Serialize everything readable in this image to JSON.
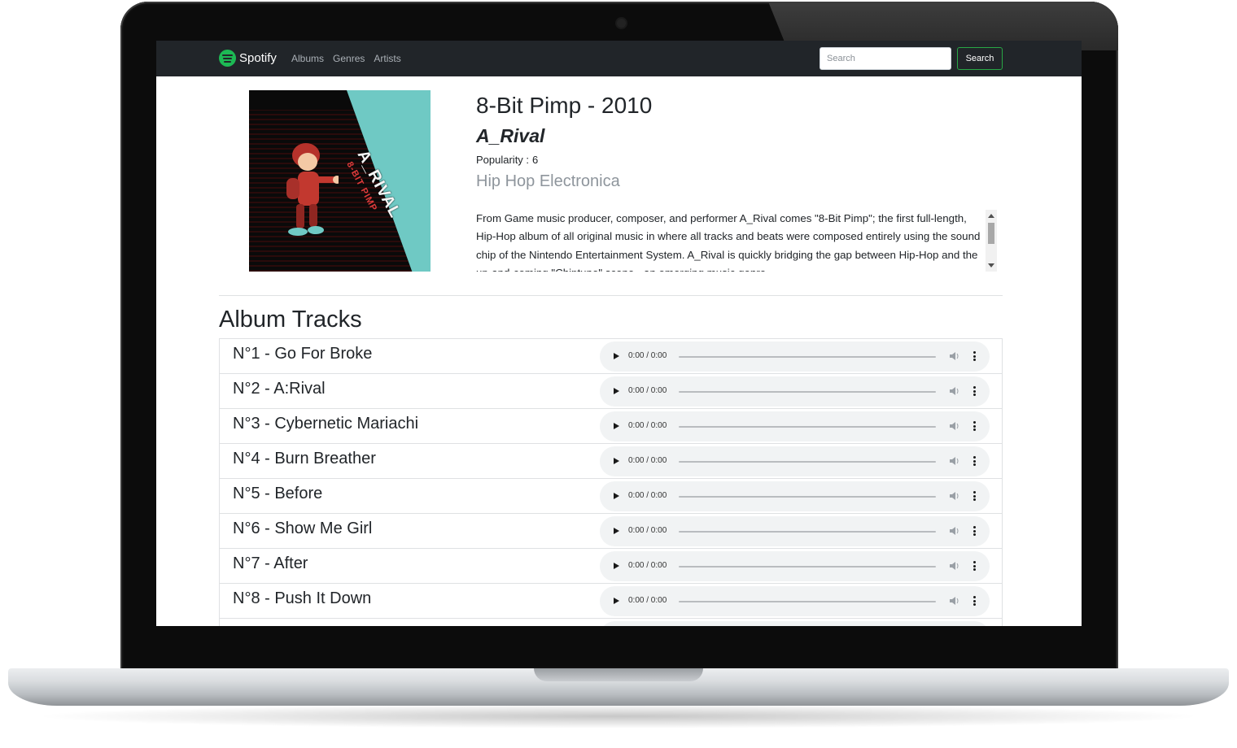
{
  "navbar": {
    "brand": "Spotify",
    "links": [
      "Albums",
      "Genres",
      "Artists"
    ],
    "search_placeholder": "Search",
    "search_button": "Search"
  },
  "album": {
    "title": "8-Bit Pimp - 2010",
    "artist": "A_Rival",
    "popularity_label": "Popularity :",
    "popularity_value": "6",
    "genres": "Hip Hop Electronica",
    "cover_title": "A_RIVAL",
    "cover_subtitle": "8-BIT PIMP",
    "description": "From Game music producer, composer, and performer A_Rival comes \"8-Bit Pimp\"; the first full-length, Hip-Hop album of all original music in where all tracks and beats were composed entirely using the sound chip of the Nintendo Entertainment System. A_Rival is quickly bridging the gap between Hip-Hop and the up-and-coming \"Chiptune\" scene - an emerging music genre"
  },
  "tracks_heading": "Album Tracks",
  "tracks": [
    {
      "name": "N°1 - Go For Broke",
      "time": "0:00 / 0:00"
    },
    {
      "name": "N°2 - A:Rival",
      "time": "0:00 / 0:00"
    },
    {
      "name": "N°3 - Cybernetic Mariachi",
      "time": "0:00 / 0:00"
    },
    {
      "name": "N°4 - Burn Breather",
      "time": "0:00 / 0:00"
    },
    {
      "name": "N°5 - Before",
      "time": "0:00 / 0:00"
    },
    {
      "name": "N°6 - Show Me Girl",
      "time": "0:00 / 0:00"
    },
    {
      "name": "N°7 - After",
      "time": "0:00 / 0:00"
    },
    {
      "name": "N°8 - Push It Down",
      "time": "0:00 / 0:00"
    },
    {
      "name": "",
      "time": ""
    }
  ],
  "colors": {
    "navbar_bg": "#212529",
    "brand_green": "#1db954",
    "search_button_border": "#28a745",
    "genre_text": "#8e959c"
  }
}
